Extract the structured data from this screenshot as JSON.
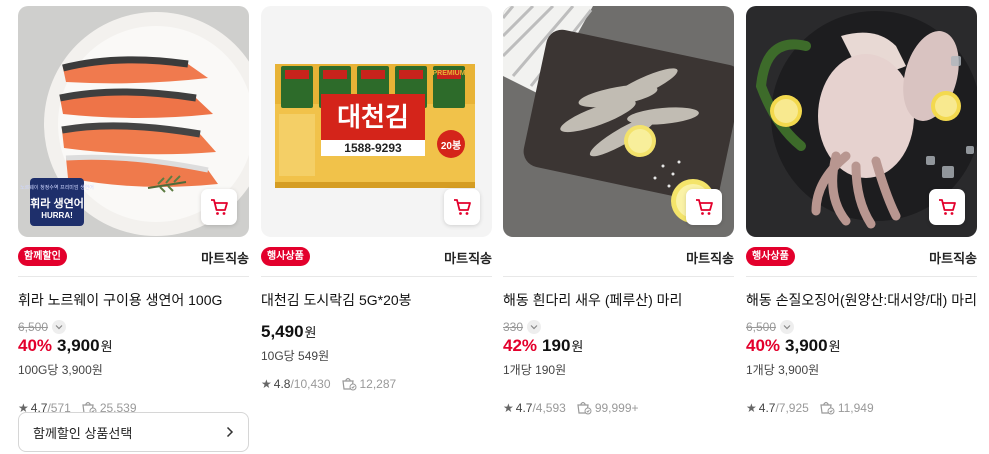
{
  "products": [
    {
      "badge": "함께할인",
      "shipping": "마트직송",
      "title": "휘라 노르웨이 구이용 생연어 100G",
      "original_price": "6,500",
      "discount_rate": "40%",
      "price": "3,900",
      "currency": "원",
      "unit_price": "100G당 3,900원",
      "rating": "4.7",
      "review_count": "571",
      "purchase_count": "25,539",
      "image_label": "휘라 생연어",
      "image_sub": "HURRA!",
      "image_tag": "노르웨이 청정수역 프리미엄 생연어",
      "bundle_label": "함께할인 상품선택"
    },
    {
      "badge": "행사상품",
      "shipping": "마트직송",
      "title": "대천김 도시락김 5G*20봉",
      "original_price": "",
      "discount_rate": "",
      "price": "5,490",
      "currency": "원",
      "unit_price": "10G당 549원",
      "rating": "4.8",
      "review_count": "10,430",
      "purchase_count": "12,287",
      "image_label": "대천김",
      "image_phone": "1588-9293",
      "image_count": "20봉",
      "image_brand": "PREMIUM"
    },
    {
      "badge": "",
      "shipping": "마트직송",
      "title": "해동 흰다리 새우 (페루산) 마리",
      "original_price": "330",
      "discount_rate": "42%",
      "price": "190",
      "currency": "원",
      "unit_price": "1개당 190원",
      "rating": "4.7",
      "review_count": "4,593",
      "purchase_count": "99,999+"
    },
    {
      "badge": "행사상품",
      "shipping": "마트직송",
      "title": "해동 손질오징어(원양산:대서양/대) 마리",
      "original_price": "6,500",
      "discount_rate": "40%",
      "price": "3,900",
      "currency": "원",
      "unit_price": "1개당 3,900원",
      "rating": "4.7",
      "review_count": "7,925",
      "purchase_count": "11,949"
    }
  ],
  "colors": {
    "accent": "#e3002c",
    "muted": "#999999",
    "divider": "#e8e8e8"
  },
  "icons": {
    "cart": "cart-icon",
    "star": "star-icon",
    "purchase": "shopping-bag-icon",
    "chevron": "chevron-right-icon"
  }
}
